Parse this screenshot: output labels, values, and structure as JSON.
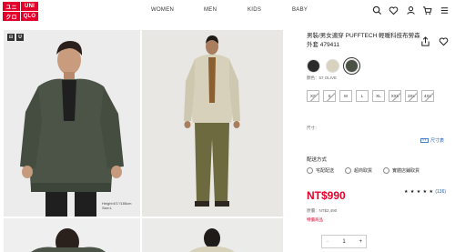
{
  "brand": {
    "logo_text": [
      "ユニ",
      "UNI",
      "クロ",
      "QLO"
    ]
  },
  "nav": {
    "items": [
      "WOMEN",
      "MEN",
      "KIDS",
      "BABY"
    ]
  },
  "header_icons": [
    "search-icon",
    "heart-icon",
    "user-icon",
    "cart-icon",
    "menu-icon"
  ],
  "gallery": {
    "badge": [
      "⊡",
      "U"
    ],
    "height_note": "Height:6'1\"/185cm\nSize:L"
  },
  "product": {
    "title": "男裝/男女適穿 PUFFTECH 輕暖科技布勞森外套 479411",
    "color_label": "顏色：57 OLIVE",
    "colors": [
      {
        "name": "black",
        "hex": "#2b2b2b"
      },
      {
        "name": "beige",
        "hex": "#d8d2bf"
      },
      {
        "name": "olive",
        "hex": "#4a5145"
      }
    ],
    "selected_color_index": 2,
    "sizes": [
      {
        "label": "XS",
        "available": false
      },
      {
        "label": "S",
        "available": false
      },
      {
        "label": "M",
        "available": true
      },
      {
        "label": "L",
        "available": true
      },
      {
        "label": "XL",
        "available": true
      },
      {
        "label": "XXL",
        "available": false
      },
      {
        "label": "3XL",
        "available": false
      },
      {
        "label": "4XL",
        "available": false
      }
    ],
    "size_label": "尺寸：",
    "size_chart_label": "尺寸表",
    "delivery_title": "配送方式",
    "delivery_options": [
      "宅配配送",
      "超商取貨",
      "實體店鋪取貨"
    ],
    "price": "NT$990",
    "original_price": "原價：NT$2,490",
    "limited": "特價商品",
    "rating_stars": "★ ★ ★ ★ ★",
    "rating_count": "(136)",
    "qty_minus": "−",
    "qty_value": "1",
    "qty_plus": "+"
  },
  "colors": {
    "accent": "#e4002b",
    "link": "#1b5db5"
  }
}
